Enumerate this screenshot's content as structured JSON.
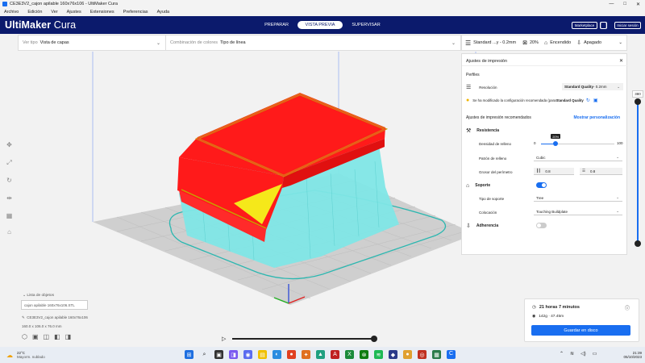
{
  "window": {
    "title": "CE3E3V2_cajon apilable 160x76x106 - UltiMaker Cura",
    "controls": [
      "—",
      "□",
      "✕"
    ]
  },
  "menu": [
    "Archivo",
    "Edición",
    "Ver",
    "Ajustes",
    "Extensiones",
    "Preferencias",
    "Ayuda"
  ],
  "header": {
    "logo_bold": "UltiMaker",
    "logo_light": " Cura",
    "stages": [
      "PREPARAR",
      "VISTA PREVIA",
      "SUPERVISAR"
    ],
    "active_stage": "VISTA PREVIA",
    "marketplace": "Marketplace",
    "signin": "Iniciar sesión"
  },
  "stagebar": {
    "view_type_label": "Ver tipo",
    "view_type_value": "Vista de capas",
    "color_scheme_label": "Combinación de colores",
    "color_scheme_value": "Tipo de línea"
  },
  "printbar": {
    "profile": "Standard ...y - 0.2mm",
    "infill": "20%",
    "support": "Encendido",
    "adhesion": "Apagado"
  },
  "panel": {
    "title": "Ajustes de impresión",
    "profiles_label": "Perfiles",
    "resolution_label": "Resolución",
    "resolution_value": "Standard Quality",
    "resolution_suffix": " - 0.2mm",
    "warning_text": "Se ha modificado la configuración recomendada (para ",
    "warning_bold": "Standard Quality",
    "recommended_title": "Ajustes de impresión recomendados",
    "custom_link": "Mostrar personalización",
    "strength_title": "Resistencia",
    "infill_density_label": "Densidad de relleno",
    "infill_min": "0",
    "infill_max": "100",
    "infill_tooltip": "20%",
    "infill_value": 20,
    "infill_pattern_label": "Patrón de relleno",
    "infill_pattern_value": "Cubic",
    "shell_label": "Grosor del perímetro",
    "shell_wall": "0.8",
    "shell_top": "0.8",
    "support_title": "Soporte",
    "support_enabled": true,
    "support_type_label": "Tipo de soporte",
    "support_type_value": "Tree",
    "placement_label": "Colocación",
    "placement_value": "Touching Buildplate",
    "adhesion_title": "Adherencia",
    "adhesion_enabled": false
  },
  "layer_max": "380",
  "objects": {
    "header": "Lista de objetos",
    "item": "cajon apilable 160x76x106.STL",
    "filename": "CE3E3V2_cajon apilable 160x76x106",
    "dims": "160.0 x 106.0 x 76.0 mm"
  },
  "print_info": {
    "time": "21 horas 7 minutos",
    "material": "142g · 47.45m",
    "save": "Guardar en disco"
  },
  "taskbar": {
    "temp": "22°C",
    "weather": "Mayorm. nublado",
    "time": "21:39",
    "date": "05/10/2023"
  },
  "colors": {
    "header": "#0b1a6c",
    "accent": "#196ef0",
    "wall": "#ff1a1a",
    "support": "#7fe6e6",
    "topskin": "#f5e81a",
    "brim": "#2bb7b0"
  }
}
